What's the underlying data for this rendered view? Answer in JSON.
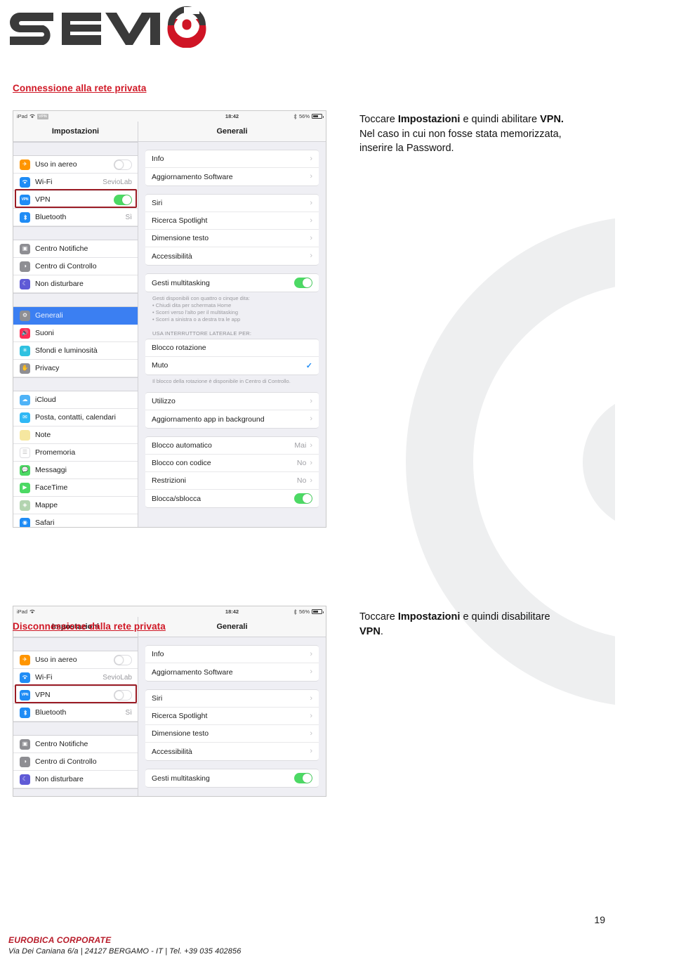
{
  "brand": {
    "logo_text": "SEVIO",
    "logo_dark": "#3a3a3a",
    "logo_red": "#cf1425"
  },
  "sections": [
    {
      "heading": "Connessione alla rete privata",
      "instruction_parts": [
        "Toccare ",
        "Impostazioni",
        " e quindi abilitare ",
        "VPN.",
        " Nel caso in cui non fosse stata memorizzata, inserire la Password."
      ]
    },
    {
      "heading": "Disconnessione dalla rete privata",
      "instruction_parts": [
        "Toccare ",
        "Impostazioni",
        " e quindi disabilitare ",
        "VPN",
        "."
      ]
    }
  ],
  "screenshot": {
    "statusbar": {
      "device": "iPad",
      "wifi_icon": "wifi-icon",
      "vpn_badge": "VPN",
      "time": "18:42",
      "bluetooth_icon": "bluetooth-icon",
      "battery_percent": "56%"
    },
    "left_pane": {
      "title": "Impostazioni",
      "groups": [
        [
          {
            "name": "airplane-mode",
            "icon": "airplane-icon",
            "label": "Uso in aereo",
            "control": "switch",
            "state_on": false,
            "state_on_2": false
          },
          {
            "name": "wifi",
            "icon": "wifi-icon",
            "label": "Wi-Fi",
            "control": "value",
            "value": "SevioLab"
          },
          {
            "name": "vpn",
            "icon": "vpn-icon",
            "label": "VPN",
            "control": "switch",
            "state_on": true,
            "state_on_2": false,
            "highlighted": true
          },
          {
            "name": "bluetooth",
            "icon": "bluetooth-icon",
            "label": "Bluetooth",
            "control": "value",
            "value": "Sì"
          }
        ],
        [
          {
            "name": "notification-center",
            "icon": "notification-icon",
            "label": "Centro Notifiche",
            "control": "none"
          },
          {
            "name": "control-center",
            "icon": "control-center-icon",
            "label": "Centro di Controllo",
            "control": "none"
          },
          {
            "name": "do-not-disturb",
            "icon": "moon-icon",
            "label": "Non disturbare",
            "control": "none"
          }
        ],
        [
          {
            "name": "general",
            "icon": "gear-icon",
            "label": "Generali",
            "control": "none",
            "selected": true
          },
          {
            "name": "sounds",
            "icon": "speaker-icon",
            "label": "Suoni",
            "control": "none"
          },
          {
            "name": "wallpaper-brightness",
            "icon": "brightness-icon",
            "label": "Sfondi e luminosità",
            "control": "none"
          },
          {
            "name": "privacy",
            "icon": "hand-icon",
            "label": "Privacy",
            "control": "none"
          }
        ],
        [
          {
            "name": "icloud",
            "icon": "cloud-icon",
            "label": "iCloud",
            "control": "none"
          },
          {
            "name": "mail-contacts-calendars",
            "icon": "mail-icon",
            "label": "Posta, contatti, calendari",
            "control": "none"
          },
          {
            "name": "notes",
            "icon": "notes-icon",
            "label": "Note",
            "control": "none"
          },
          {
            "name": "reminders",
            "icon": "reminders-icon",
            "label": "Promemoria",
            "control": "none"
          },
          {
            "name": "messages",
            "icon": "messages-icon",
            "label": "Messaggi",
            "control": "none"
          },
          {
            "name": "facetime",
            "icon": "facetime-icon",
            "label": "FaceTime",
            "control": "none"
          },
          {
            "name": "maps",
            "icon": "maps-icon",
            "label": "Mappe",
            "control": "none"
          },
          {
            "name": "safari",
            "icon": "safari-icon",
            "label": "Safari",
            "control": "none"
          }
        ]
      ]
    },
    "right_pane": {
      "title": "Generali",
      "card1": [
        {
          "name": "info",
          "label": "Info",
          "accessory": "chevron"
        },
        {
          "name": "software-update",
          "label": "Aggiornamento Software",
          "accessory": "chevron"
        }
      ],
      "card2": [
        {
          "name": "siri",
          "label": "Siri",
          "accessory": "chevron"
        },
        {
          "name": "spotlight-search",
          "label": "Ricerca Spotlight",
          "accessory": "chevron"
        },
        {
          "name": "text-size",
          "label": "Dimensione testo",
          "accessory": "chevron"
        },
        {
          "name": "accessibility",
          "label": "Accessibilità",
          "accessory": "chevron"
        }
      ],
      "card3": [
        {
          "name": "multitasking-gestures",
          "label": "Gesti multitasking",
          "accessory": "switch",
          "state_on": true
        }
      ],
      "gestures_note": "Gesti disponibili con quattro o cinque dita:\n• Chiudi dita per schermata Home\n• Scorri verso l'alto per il multitasking\n• Scorri a sinistra o a destra tra le app",
      "side_switch_label": "USA INTERRUTTORE LATERALE PER:",
      "card4": [
        {
          "name": "rotation-lock",
          "label": "Blocco rotazione",
          "accessory": "none"
        },
        {
          "name": "mute",
          "label": "Muto",
          "accessory": "check"
        }
      ],
      "rotation_note": "Il blocco della rotazione è disponibile in Centro di Controllo.",
      "card5": [
        {
          "name": "usage",
          "label": "Utilizzo",
          "accessory": "chevron"
        },
        {
          "name": "background-app-refresh",
          "label": "Aggiornamento app in background",
          "accessory": "chevron"
        }
      ],
      "card6": [
        {
          "name": "auto-lock",
          "label": "Blocco automatico",
          "value": "Mai",
          "accessory": "chevron"
        },
        {
          "name": "passcode-lock",
          "label": "Blocco con codice",
          "value": "No",
          "accessory": "chevron"
        },
        {
          "name": "restrictions",
          "label": "Restrizioni",
          "value": "No",
          "accessory": "chevron"
        },
        {
          "name": "lock-unlock",
          "label": "Blocca/sblocca",
          "accessory": "switch",
          "state_on": true
        }
      ]
    }
  },
  "footer": {
    "company": "EUROBICA CORPORATE",
    "address": "Via Dei Caniana 6/a | 24127 BERGAMO - IT | Tel. +39 035 402856",
    "page_number": "19",
    "company_color": "#b81c2a"
  }
}
